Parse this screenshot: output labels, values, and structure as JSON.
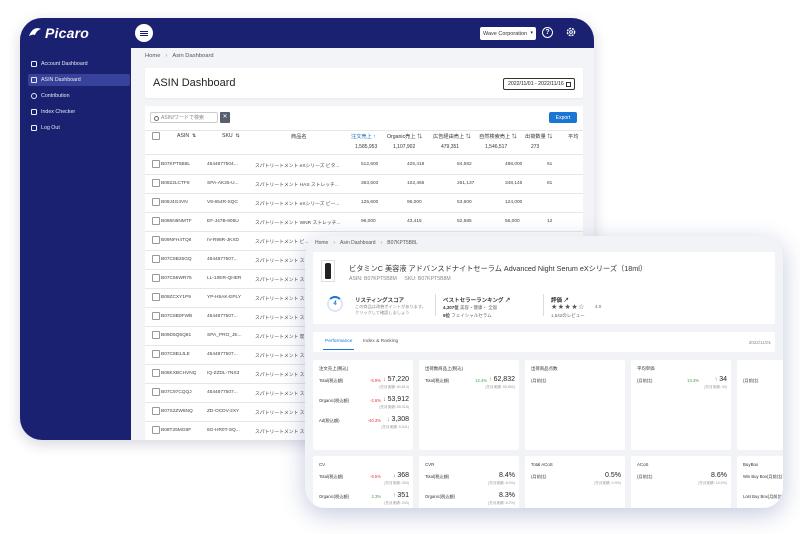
{
  "back": {
    "logo_text": "Picaro",
    "org_select": "Wave Corporation",
    "sidebar": [
      {
        "label": "Account Dashboard",
        "icon": "grid-icon"
      },
      {
        "label": "ASIN Dashboard",
        "icon": "list-icon"
      },
      {
        "label": "Contribution",
        "icon": "star-icon"
      },
      {
        "label": "Index Checker",
        "icon": "check-icon"
      },
      {
        "label": "Log Out",
        "icon": "logout-icon"
      }
    ],
    "breadcrumb": [
      "Home",
      "Asin Dashboard"
    ],
    "page_title": "ASIN Dashboard",
    "date_range": "2022/11/01 - 2022/11/16",
    "search_placeholder": "ASIN/ワードで検索",
    "clear_label": "✕",
    "export_label": "Export",
    "columns": [
      "ASIN",
      "SKU",
      "商品名",
      "注文売上",
      "Organic売上",
      "広告経由売上",
      "自然検索売上",
      "出荷数量",
      "平均"
    ],
    "totals": [
      "1,585,953",
      "1,107,902",
      "479,351",
      "1,546,517",
      "273"
    ],
    "rows": [
      {
        "asin": "B07KPT5B8L",
        "sku": "4544877504...",
        "name": "スパトリートメント eXシリーズ ビタ...",
        "v1": "512,600",
        "v2": "425,418",
        "v3": "84,582",
        "v4": "488,000",
        "v5": "61"
      },
      {
        "asin": "B0822LCTF8",
        "sku": "SPA-AK25-U...",
        "name": "スパトリートメント HAS ストレッチ...",
        "v1": "363,603",
        "v2": "102,466",
        "v3": "261,137",
        "v4": "348,145",
        "v5": "81"
      },
      {
        "asin": "B08J4G4VN",
        "sku": "V8-654R-SQC",
        "name": "スパトリートメント eXシリーズ ビー...",
        "v1": "125,600",
        "v2": "96,000",
        "v3": "53,600",
        "v4": "124,000",
        "v5": ""
      },
      {
        "asin": "B086N6NMTF",
        "sku": "EF-J47B-905U",
        "name": "スパトリートメント WNR ストレッチ...",
        "v1": "96,000",
        "v2": "43,415",
        "v3": "52,585",
        "v4": "56,000",
        "v5": "12"
      },
      {
        "asin": "B09NFH4TQ6",
        "sku": "IV-R98R-JKXD",
        "name": "スパトリートメント ビ...",
        "v1": "",
        "v2": "",
        "v3": "",
        "v4": "",
        "v5": ""
      },
      {
        "asin": "B07C8B26GQ",
        "sku": "4544877507...",
        "name": "スパトリートメント ス...",
        "v1": "",
        "v2": "",
        "v3": "",
        "v4": "",
        "v5": ""
      },
      {
        "asin": "B07C55WR75",
        "sku": "LL-10ER-QHER",
        "name": "スパトリートメント ス...",
        "v1": "",
        "v2": "",
        "v3": "",
        "v4": "",
        "v5": ""
      },
      {
        "asin": "B09ZCXY1P9",
        "sku": "YP-H5AK-EPLY",
        "name": "スパトリートメント ス...",
        "v1": "",
        "v2": "",
        "v3": "",
        "v4": "",
        "v5": ""
      },
      {
        "asin": "B07C8B0FWB",
        "sku": "4544877507...",
        "name": "スパトリートメント ス...",
        "v1": "",
        "v2": "",
        "v3": "",
        "v4": "",
        "v5": ""
      },
      {
        "asin": "B09D5Q5Q81",
        "sku": "SPA_PRO_JE...",
        "name": "スパトリートメント 炭...",
        "v1": "",
        "v2": "",
        "v3": "",
        "v4": "",
        "v5": ""
      },
      {
        "asin": "B07C8B1JLE",
        "sku": "4544877507...",
        "name": "スパトリートメント ス...",
        "v1": "",
        "v2": "",
        "v3": "",
        "v4": "",
        "v5": ""
      },
      {
        "asin": "B08KXBCHVNQ",
        "sku": "IQ-ZZDL-7NS3",
        "name": "スパトリートメント ス...",
        "v1": "",
        "v2": "",
        "v3": "",
        "v4": "",
        "v5": ""
      },
      {
        "asin": "B07C97CQQJ",
        "sku": "4544877507...",
        "name": "スパトリートメント ス...",
        "v1": "",
        "v2": "",
        "v3": "",
        "v4": "",
        "v5": ""
      },
      {
        "asin": "B07S2ZW6NQ",
        "sku": "ZD-OCDV-2XY",
        "name": "スパトリートメント ス...",
        "v1": "",
        "v2": "",
        "v3": "",
        "v4": "",
        "v5": ""
      },
      {
        "asin": "B08T25MG8F",
        "sku": "6G-HR0T-SQ...",
        "name": "スパトリートメント ス...",
        "v1": "",
        "v2": "",
        "v3": "",
        "v4": "",
        "v5": ""
      }
    ]
  },
  "front": {
    "breadcrumb": [
      "Home",
      "Asin Dashboard",
      "B07KPT5B8L"
    ],
    "product_name": "ビタミンC 美容液 アドバンスドナイトセーラム Advanced Night Serum eXシリーズ（18ml）",
    "asin_line": "ASIN: B07KPT5B8M",
    "sku_line": "SKU: B07KPT5B8M",
    "score_value": "4",
    "score_label": "リスティングスコア",
    "score_desc": "この商品は改善ポイントがあります。クリックして確認しましょう",
    "bsr_label": "ベストセラーランキング",
    "bsr_line1_rank": "4,307位",
    "bsr_line1_cat": "美容・健康・ 全般",
    "bsr_line2_rank": "9位",
    "bsr_line2_cat": "フェイシャルセラム",
    "rating_label": "評価",
    "rating_stars": "★★★★☆",
    "rating_value": "4.0",
    "rating_count": "1,542のレビュー",
    "tabs": [
      "Performance",
      "Index & Ranking"
    ],
    "tab_date": "2022/11/01",
    "cards_row1": [
      {
        "title": "注文売上(税込)",
        "rows": [
          {
            "label": "Total(税込額)",
            "pct": "-5.9%",
            "dir": "down",
            "value": "57,220",
            "sub": "(先月実績: 60,814)"
          },
          {
            "label": "Organic(税込額)",
            "pct": "-2.6%",
            "dir": "down",
            "value": "53,912",
            "sub": "(先月実績: 55,318)"
          },
          {
            "label": "Ad(税込額)",
            "pct": "-40.3%",
            "dir": "down",
            "value": "3,308",
            "sub": "(先月実績: 5,541)"
          }
        ]
      },
      {
        "title": "出荷数商品上(税込)",
        "rows": [
          {
            "label": "Total(税込額)",
            "pct": "12.4%",
            "dir": "up",
            "value": "62,832",
            "sub": "(先月実績: 55,892)"
          }
        ]
      },
      {
        "title": "出荷商品点数",
        "rows": [
          {
            "label": "(月前比)",
            "pct": "",
            "dir": "up",
            "value": "",
            "sub": ""
          }
        ]
      },
      {
        "title": "平均単価",
        "rows": [
          {
            "label": "(月前比)",
            "pct": "13.3%",
            "dir": "up",
            "value": "34",
            "sub": "(先月実績: 30)"
          }
        ]
      },
      {
        "title": "",
        "rows": [
          {
            "label": "(月前比)",
            "pct": "-6%",
            "dir": "down",
            "value": "1,848",
            "sub": "(先月実績: 1,966)"
          }
        ]
      },
      {
        "title": "",
        "rows": [
          {
            "label": "総利用(月前比)",
            "pct": "",
            "dir": "up",
            "value": "",
            "sub": ""
          },
          {
            "label": "総利用(月前比)",
            "pct": "",
            "dir": "up",
            "value": "",
            "sub": ""
          }
        ]
      }
    ],
    "cards_row2": [
      {
        "title": "CV",
        "rows": [
          {
            "label": "Total(税込額)",
            "pct": "-6.5%",
            "dir": "down",
            "value": "368",
            "sub": "(先月実績: 394)"
          },
          {
            "label": "Organic(税込額)",
            "pct": "2.3%",
            "dir": "up",
            "value": "351",
            "sub": "(先月実績: 343)"
          }
        ]
      },
      {
        "title": "CVR",
        "rows": [
          {
            "label": "Total(税込額)",
            "pct": "",
            "dir": "up",
            "value": "8.4%",
            "sub": "(先月実績: 8.0%)"
          },
          {
            "label": "Organic(税込額)",
            "pct": "",
            "dir": "up",
            "value": "8.3%",
            "sub": "(先月実績: 8.2%)"
          }
        ]
      },
      {
        "title": "Total ACoS",
        "rows": [
          {
            "label": "(月前比)",
            "pct": "",
            "dir": "up",
            "value": "0.5%",
            "sub": "(先月実績: 0.9%)"
          }
        ]
      },
      {
        "title": "ACoS",
        "rows": [
          {
            "label": "(月前比)",
            "pct": "",
            "dir": "up",
            "value": "8.6%",
            "sub": "(先月実績: 15.0%)"
          }
        ]
      },
      {
        "title": "BuyBox",
        "rows": [
          {
            "label": "Win Buy Box(月前比)",
            "pct": "",
            "dir": "up",
            "value": "",
            "sub": ""
          },
          {
            "label": "Lost Buy Box(月前比)",
            "pct": "",
            "dir": "up",
            "value": "",
            "sub": ""
          }
        ]
      }
    ]
  }
}
